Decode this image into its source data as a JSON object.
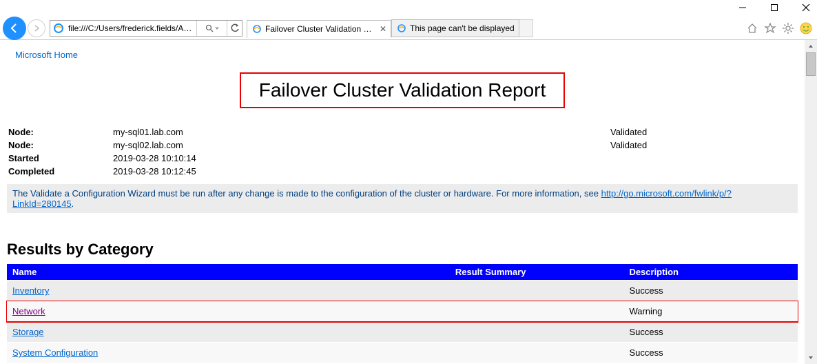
{
  "titlebar": {},
  "toolbar": {
    "address": "file:///C:/Users/frederick.fields/AppData/Lo"
  },
  "tabs": {
    "active": "Failover Cluster Validation R...",
    "inactive": "This page can't be displayed"
  },
  "header_link": "Microsoft Home",
  "report_title": "Failover Cluster Validation Report",
  "meta": [
    {
      "label": "Node:",
      "value": "my-sql01.lab.com",
      "status": "Validated"
    },
    {
      "label": "Node:",
      "value": "my-sql02.lab.com",
      "status": "Validated"
    },
    {
      "label": "Started",
      "value": "2019-03-28 10:10:14",
      "status": ""
    },
    {
      "label": "Completed",
      "value": "2019-03-28 10:12:45",
      "status": ""
    }
  ],
  "notice": {
    "text_before": "The Validate a Configuration Wizard must be run after any change is made to the configuration of the cluster or hardware. For more information, see ",
    "link_text": "http://go.microsoft.com/fwlink/p/?LinkId=280145",
    "text_after": "."
  },
  "results_heading": "Results by Category",
  "results_columns": {
    "name": "Name",
    "summary": "Result Summary",
    "desc": "Description"
  },
  "results": [
    {
      "name": "Inventory",
      "desc": "Success",
      "visited": false
    },
    {
      "name": "Network",
      "desc": "Warning",
      "visited": true,
      "highlight": true
    },
    {
      "name": "Storage",
      "desc": "Success",
      "visited": false
    },
    {
      "name": "System Configuration",
      "desc": "Success",
      "visited": false
    }
  ]
}
